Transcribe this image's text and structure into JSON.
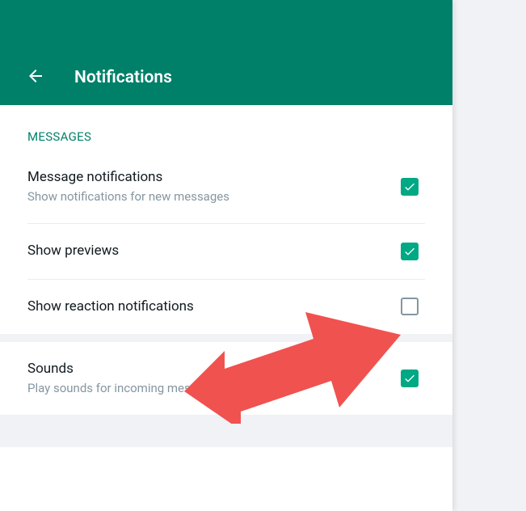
{
  "header": {
    "title": "Notifications"
  },
  "sections": {
    "messages": {
      "label": "MESSAGES",
      "items": {
        "message_notifications": {
          "title": "Message notifications",
          "subtitle": "Show notifications for new messages",
          "checked": true
        },
        "show_previews": {
          "title": "Show previews",
          "checked": true
        },
        "show_reaction_notifications": {
          "title": "Show reaction notifications",
          "checked": false
        }
      }
    },
    "sounds": {
      "items": {
        "sounds": {
          "title": "Sounds",
          "subtitle": "Play sounds for incoming messages",
          "checked": true
        }
      }
    }
  },
  "colors": {
    "accent": "#008069",
    "checkbox": "#00a884",
    "arrow": "#f0524f"
  },
  "annotation": {
    "arrow_points_to": "show_reaction_notifications_checkbox"
  }
}
